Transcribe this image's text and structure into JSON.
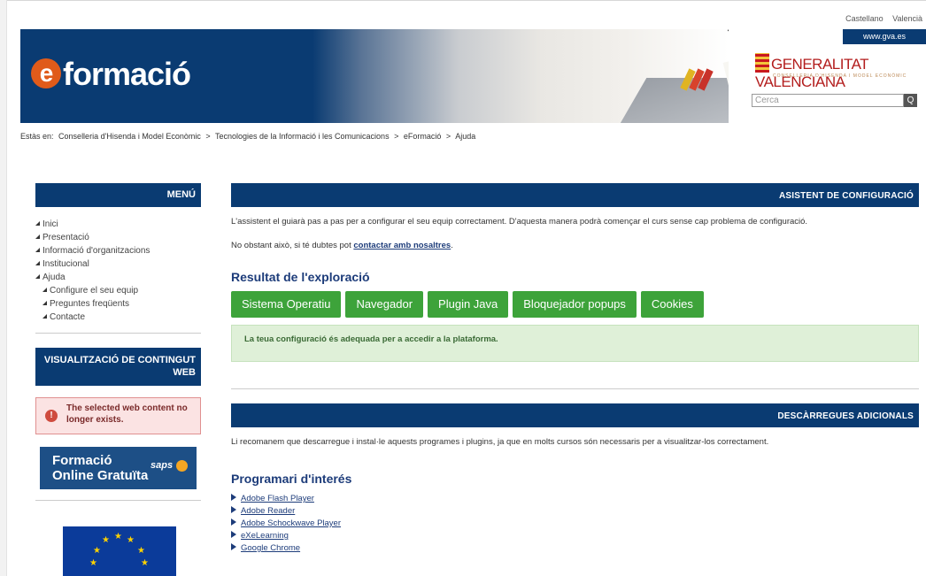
{
  "header": {
    "languages": [
      "Castellano",
      "Valencià"
    ],
    "gva_url": "www.gva.es",
    "brand_logo": "eformació",
    "gov_logo": "GENERALITAT VALENCIANA",
    "gov_sub": "CONSELLERIA D'HISENDA I MODEL ECONÒMIC",
    "search_placeholder": "Cerca",
    "search_button": "Q"
  },
  "breadcrumb": {
    "prefix": "Estàs en:",
    "items": [
      "Conselleria d'Hisenda i Model Econòmic",
      "Tecnologies de la Informació i les Comunicacions",
      "eFormació",
      "Ajuda"
    ],
    "separator": ">"
  },
  "sidebar": {
    "menu_title": "MENÚ",
    "items": [
      {
        "label": "Inici"
      },
      {
        "label": "Presentació"
      },
      {
        "label": "Informació d'organitzacions"
      },
      {
        "label": "Institucional"
      },
      {
        "label": "Ajuda"
      },
      {
        "label": "Configure el seu equip"
      },
      {
        "label": "Preguntes freqüents"
      },
      {
        "label": "Contacte"
      }
    ],
    "web_content_title": "VISUALITZACIÓ DE CONTINGUT WEB",
    "error_message": "The selected web content no longer exists.",
    "saps_line1": "Formació",
    "saps_line2": "Online Gratuïta",
    "saps_brand": "saps"
  },
  "main": {
    "config_title": "ASISTENT DE CONFIGURACIÓ",
    "intro": "L'assistent el guiarà pas a pas per a configurar el seu equip correctament. D'aquesta manera podrà començar el curs sense cap problema de configuració.",
    "contact_prefix": "No obstant això, si té dubtes pot",
    "contact_link": "contactar amb nosaltres",
    "contact_suffix": ".",
    "result_title": "Resultat de l'exploració",
    "buttons": [
      "Sistema Operatiu",
      "Navegador",
      "Plugin Java",
      "Bloquejador popups",
      "Cookies"
    ],
    "success_message": "La teua configuració és adequada per a accedir a la plataforma.",
    "downloads_title": "DESCÀRREGUES ADICIONALS",
    "downloads_intro": "Li recomanem que descarregue i instal·le aquests programes i plugins, ja que en molts cursos són necessaris per a visualitzar-los correctament.",
    "software_title": "Programari d'interés",
    "software": [
      "Adobe Flash Player",
      "Adobe Reader",
      "Adobe Schockwave Player",
      "eXeLearning",
      "Google Chrome"
    ]
  },
  "colors": {
    "navy": "#0a3b72",
    "green_button": "#3da33a",
    "success_bg": "#dff0d8",
    "error_bg": "#fbe3e3",
    "link": "#1d3c7a"
  }
}
